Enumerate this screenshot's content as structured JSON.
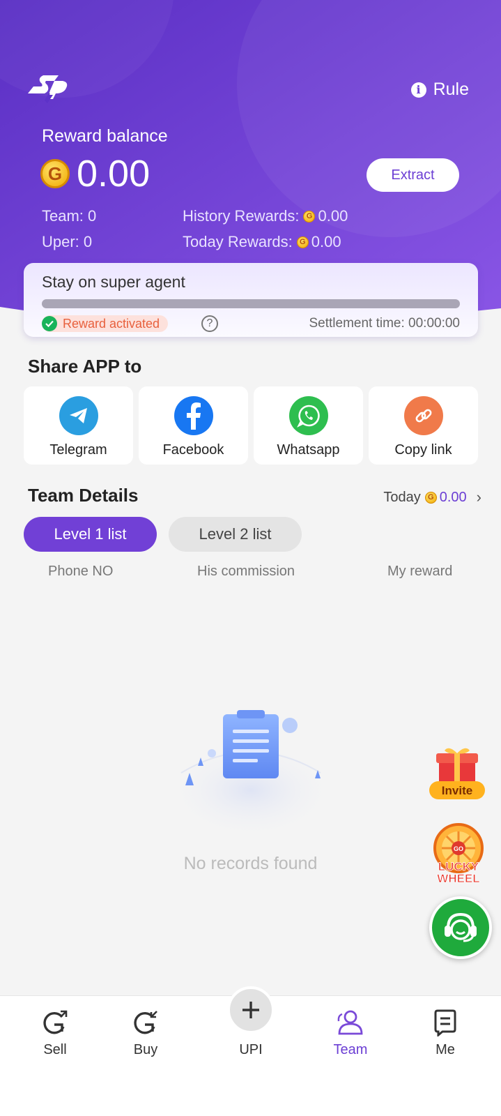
{
  "header": {
    "rule_label": "Rule"
  },
  "reward": {
    "label": "Reward balance",
    "amount": "0.00",
    "extract_label": "Extract",
    "team_label": "Team: 0",
    "uper_label": "Uper: 0",
    "history_label": "History Rewards:",
    "history_value": "0.00",
    "today_label": "Today Rewards:",
    "today_value": "0.00"
  },
  "agent": {
    "title": "Stay on super agent",
    "progress": 0,
    "badge": "Reward activated",
    "help": "?",
    "settlement": "Settlement time: 00:00:00"
  },
  "share": {
    "title": "Share APP to",
    "items": [
      {
        "label": "Telegram",
        "icon": "telegram-icon",
        "color": "#2a9ee0"
      },
      {
        "label": "Facebook",
        "icon": "facebook-icon",
        "color": "#1877f2"
      },
      {
        "label": "Whatsapp",
        "icon": "whatsapp-icon",
        "color": "#2ebe4f"
      },
      {
        "label": "Copy link",
        "icon": "link-icon",
        "color": "#f07a4a"
      }
    ]
  },
  "team": {
    "title": "Team Details",
    "today_label": "Today",
    "today_value": "0.00",
    "tabs": [
      {
        "label": "Level 1 list",
        "active": true
      },
      {
        "label": "Level 2 list",
        "active": false
      }
    ],
    "columns": [
      "Phone NO",
      "His commission",
      "My reward"
    ],
    "empty_text": "No records found"
  },
  "floating": {
    "invite_label": "Invite",
    "lucky_line1": "LUCKY",
    "lucky_line2": "WHEEL",
    "lucky_go": "GO"
  },
  "nav": {
    "items": [
      {
        "label": "Sell",
        "icon": "sell-icon"
      },
      {
        "label": "Buy",
        "icon": "buy-icon"
      },
      {
        "label": "UPI",
        "icon": "plus-icon"
      },
      {
        "label": "Team",
        "icon": "team-icon",
        "active": true
      },
      {
        "label": "Me",
        "icon": "me-icon"
      }
    ]
  },
  "colors": {
    "brand": "#6c3fd4",
    "hero_start": "#5d32c8",
    "hero_end": "#8b55e8"
  }
}
